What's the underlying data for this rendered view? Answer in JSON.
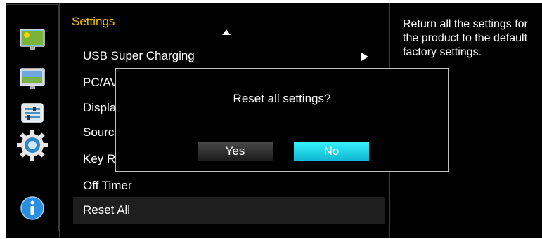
{
  "menu": {
    "title": "Settings",
    "items": [
      {
        "label": "USB Super Charging",
        "has_submenu": true
      },
      {
        "label": "PC/AV Mode"
      },
      {
        "label": "Display Port Ver."
      },
      {
        "label": "Source Detection"
      },
      {
        "label": "Key Repeat Time"
      },
      {
        "label": "Off Timer"
      },
      {
        "label": "Reset All",
        "selected": true
      }
    ]
  },
  "sidebar": {
    "icons": [
      "picture-icon",
      "onscreen-display-icon",
      "system-icon",
      "settings-gear-icon",
      "information-icon"
    ]
  },
  "help": {
    "text": "Return all the settings for the product to the default factory settings."
  },
  "dialog": {
    "message": "Reset all settings?",
    "yes_label": "Yes",
    "no_label": "No",
    "focused": "No"
  },
  "colors": {
    "title": "#f3c400",
    "focus": "#1fd6ea"
  }
}
